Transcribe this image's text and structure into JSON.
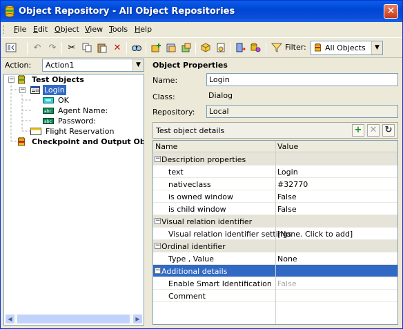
{
  "window": {
    "title": "Object Repository - All Object Repositories"
  },
  "menu": [
    {
      "ul": "F",
      "rest": "ile"
    },
    {
      "ul": "E",
      "rest": "dit"
    },
    {
      "ul": "O",
      "rest": "bject"
    },
    {
      "ul": "V",
      "rest": "iew"
    },
    {
      "ul": "T",
      "rest": "ools"
    },
    {
      "ul": "H",
      "rest": "elp"
    }
  ],
  "toolbar": {
    "icons": [
      "navigate-icon",
      "undo-icon",
      "redo-icon",
      "cut-icon",
      "copy-icon",
      "paste-icon",
      "delete-icon",
      "find-icon",
      "add-objects-icon",
      "update-icon",
      "export-icon",
      "object-spy-icon",
      "highlight-icon",
      "local-to-shared-icon",
      "associate-icon"
    ],
    "filter_label": "Filter:",
    "filter_value": "All Objects"
  },
  "action": {
    "label": "Action:",
    "value": "Action1"
  },
  "tree": {
    "root": "Test Objects",
    "login": "Login",
    "ok": "OK",
    "agent_name": "Agent Name:",
    "password": "Password:",
    "flight": "Flight Reservation",
    "checkpoint": "Checkpoint and Output Object"
  },
  "properties": {
    "title": "Object Properties",
    "name_label": "Name:",
    "name_value": "Login",
    "class_label": "Class:",
    "class_value": "Dialog",
    "repo_label": "Repository:",
    "repo_value": "Local"
  },
  "details": {
    "label": "Test object details",
    "col_name": "Name",
    "col_value": "Value",
    "rows": [
      {
        "type": "cat",
        "name": "Description properties"
      },
      {
        "type": "prop",
        "name": "text",
        "value": "Login"
      },
      {
        "type": "prop",
        "name": "nativeclass",
        "value": "#32770"
      },
      {
        "type": "prop",
        "name": "is owned window",
        "value": "False"
      },
      {
        "type": "prop",
        "name": "is child window",
        "value": "False"
      },
      {
        "type": "cat",
        "name": "Visual relation identifier"
      },
      {
        "type": "prop",
        "name": "Visual relation identifier settings",
        "value": "[None. Click to add]"
      },
      {
        "type": "cat",
        "name": "Ordinal identifier"
      },
      {
        "type": "prop",
        "name": "Type , Value",
        "value": "None"
      },
      {
        "type": "cat",
        "name": "Additional details",
        "selected": true
      },
      {
        "type": "prop",
        "name": "Enable Smart Identification",
        "value": "False",
        "disabled": true
      },
      {
        "type": "prop",
        "name": "Comment",
        "value": ""
      }
    ]
  }
}
